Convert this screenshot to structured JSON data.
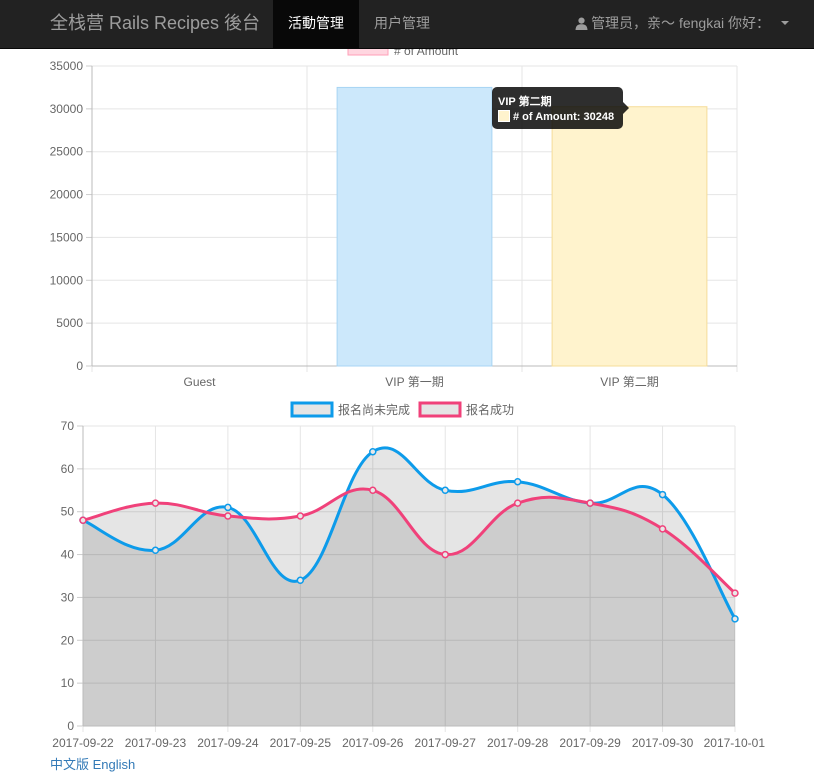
{
  "navbar": {
    "brand": "全栈营 Rails Recipes 後台",
    "items": [
      {
        "label": "活動管理",
        "active": true
      },
      {
        "label": "用户管理",
        "active": false
      }
    ],
    "user_label": "管理员，亲～ fengkai 你好：",
    "user_icon": "user-icon",
    "bg_color": "#222222"
  },
  "tooltip": {
    "title": "VIP 第二期",
    "line": "# of Amount: 30248"
  },
  "footer": {
    "links": [
      "中文版",
      "English"
    ]
  },
  "chart_data": [
    {
      "type": "bar",
      "categories": [
        "Guest",
        "VIP 第一期",
        "VIP 第二期"
      ],
      "series": [
        {
          "name": "# of Amount",
          "values": [
            0,
            32500,
            30248
          ]
        }
      ],
      "ylim": [
        0,
        35000
      ],
      "yticks": [
        0,
        5000,
        10000,
        15000,
        20000,
        25000,
        30000,
        35000
      ],
      "bar_colors": [
        "#ffd6e0",
        "#cce8fb",
        "#fff3cd"
      ],
      "bar_border_colors": [
        "#ff9fb7",
        "#a7d4f4",
        "#f5dc99"
      ],
      "legend_color": "#ffd6e0",
      "legend": "top",
      "grid": true
    },
    {
      "type": "line",
      "categories": [
        "2017-09-22",
        "2017-09-23",
        "2017-09-24",
        "2017-09-25",
        "2017-09-26",
        "2017-09-27",
        "2017-09-28",
        "2017-09-29",
        "2017-09-30",
        "2017-10-01"
      ],
      "series": [
        {
          "name": "报名尚未完成",
          "values": [
            48,
            41,
            51,
            34,
            64,
            55,
            57,
            52,
            54,
            25
          ],
          "color": "#0d9bea"
        },
        {
          "name": "报名成功",
          "values": [
            48,
            52,
            49,
            49,
            55,
            40,
            52,
            52,
            46,
            31
          ],
          "color": "#f0417a"
        }
      ],
      "ylim": [
        0,
        70
      ],
      "yticks": [
        0,
        10,
        20,
        30,
        40,
        50,
        60,
        70
      ],
      "fill_color": "rgba(0,0,0,0.1)",
      "legend": "top",
      "grid": true
    }
  ]
}
